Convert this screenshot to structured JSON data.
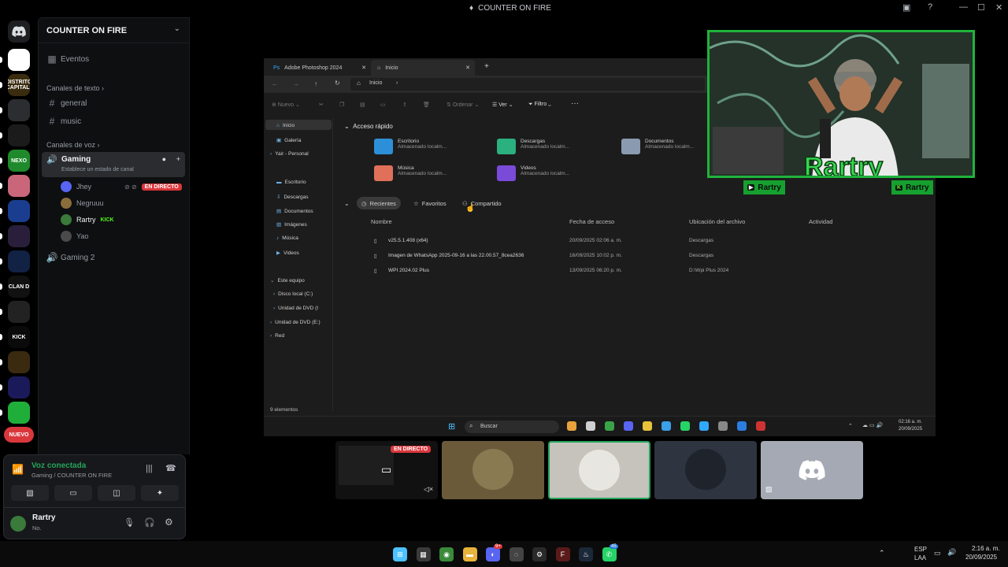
{
  "window": {
    "title": "COUNTER ON FIRE"
  },
  "rail": {
    "servers": [
      {
        "label": "",
        "color": "#ffffff"
      },
      {
        "label": "DISTRITO CAPITAL",
        "color": "#3a2c0f"
      },
      {
        "label": "",
        "color": "#2b2d31"
      },
      {
        "label": "",
        "color": "#1b1b1b"
      },
      {
        "label": "NEXO",
        "color": "#1f8a2b"
      },
      {
        "label": "",
        "color": "#c9667a"
      },
      {
        "label": "",
        "color": "#1a3d8f"
      },
      {
        "label": "",
        "color": "#2a1f3a"
      },
      {
        "label": "",
        "color": "#112244"
      },
      {
        "label": "CLAN D",
        "color": "#111111"
      },
      {
        "label": "",
        "color": "#222222"
      },
      {
        "label": "KICK",
        "color": "#0a0a0a"
      },
      {
        "label": "",
        "color": "#3a2a10"
      },
      {
        "label": "",
        "color": "#1a1a5a"
      },
      {
        "label": "",
        "color": "#1fae3a"
      }
    ],
    "new_badge": "NUEVO"
  },
  "sidebar": {
    "server_name": "COUNTER ON FIRE",
    "events_label": "Eventos",
    "text_category": "Canales de texto",
    "text_channels": [
      "general",
      "music"
    ],
    "voice_category": "Canales de voz",
    "active_channel": "Gaming",
    "status_hint": "Establece un estado de canal",
    "members": [
      {
        "name": "Jhey",
        "badge": "EN DIRECTO",
        "color": "#5865f2"
      },
      {
        "name": "Negruuu",
        "badge": "",
        "color": "#8a6d3b"
      },
      {
        "name": "Rartry",
        "badge": "KICK",
        "color": "#3a7a3a"
      },
      {
        "name": "Yao",
        "badge": "",
        "color": "#4a4a4a"
      }
    ],
    "other_channel": "Gaming 2"
  },
  "voice_panel": {
    "status": "Voz conectada",
    "location": "Gaming / COUNTER ON FIRE"
  },
  "user": {
    "name": "Rartry",
    "status": "No."
  },
  "stream": {
    "tabs": [
      "Adobe Photoshop 2024",
      "Inicio"
    ],
    "address": "Inicio",
    "toolbar": [
      "Nuevo",
      "Ordenar",
      "Ver",
      "Filtro"
    ],
    "nav_items": [
      "Inicio",
      "Galería",
      "Yair - Personal",
      "Escritorio",
      "Descargas",
      "Documentos",
      "Imágenes",
      "Música",
      "Videos",
      "Este equipo",
      "Disco local (C:)",
      "Unidad de DVD (I",
      "Unidad de DVD (E:)",
      "Red"
    ],
    "quick_access_title": "Acceso rápido",
    "quick_access": [
      {
        "name": "Escritorio",
        "sub": "Almacenado localm...",
        "color": "#2d8fd8"
      },
      {
        "name": "Descargas",
        "sub": "Almacenado localm...",
        "color": "#2bb07f"
      },
      {
        "name": "Documentos",
        "sub": "Almacenado localm...",
        "color": "#8a9bb0"
      },
      {
        "name": "Música",
        "sub": "Almacenado localm...",
        "color": "#e0705a"
      },
      {
        "name": "Videos",
        "sub": "Almacenado localm...",
        "color": "#7a4ad8"
      }
    ],
    "filters": [
      "Recientes",
      "Favoritos",
      "Compartido"
    ],
    "columns": [
      "Nombre",
      "Fecha de acceso",
      "Ubicación del archivo",
      "Actividad"
    ],
    "files": [
      {
        "name": "v25.5.1.408 (x64)",
        "date": "20/09/2025 02:06 a. m.",
        "location": "Descargas"
      },
      {
        "name": "Imagen de WhatsApp 2025-09-16 a las 22.00.57_8cea2636",
        "date": "16/09/2025 10:02 p. m.",
        "location": "Descargas"
      },
      {
        "name": "WPI 2024.02 Plus",
        "date": "13/09/2025 06:20 p. m.",
        "location": "D:\\Wpi Plus 2024"
      }
    ],
    "item_count": "9 elementos",
    "search_placeholder": "Buscar",
    "clock_time": "02:16 a. m.",
    "clock_date": "20/09/2025"
  },
  "webcam": {
    "name": "Rartry"
  },
  "tiles": {
    "live_label": "EN DIRECTO"
  },
  "taskbar": {
    "lang": "ESP",
    "lang2": "LAA",
    "time": "2:16 a. m.",
    "date": "20/09/2025",
    "discord_badge": "9+",
    "whatsapp_badge": "45"
  }
}
